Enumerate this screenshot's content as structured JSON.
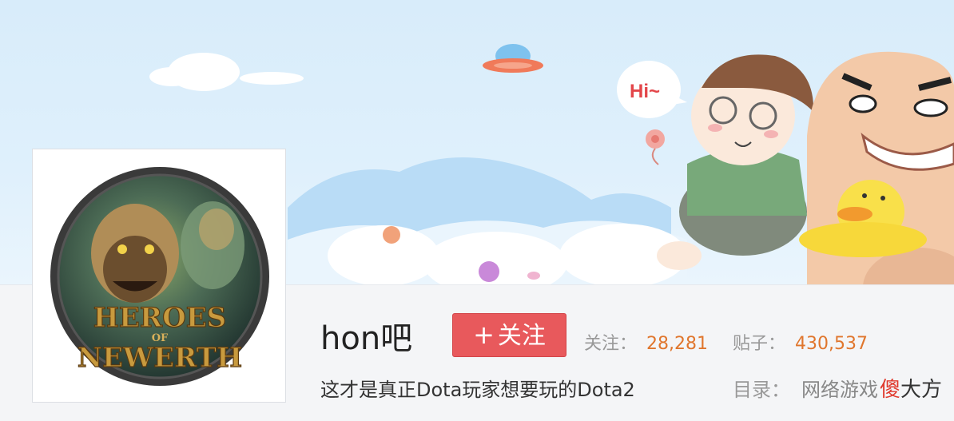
{
  "banner": {
    "speech_bubble": "Hi~"
  },
  "forum": {
    "logo_line1": "HEROES",
    "logo_line2": "OF",
    "logo_line3": "NEWERTH",
    "name": "hon吧",
    "follow_button": "关注",
    "follow_icon": "plus-icon",
    "followers_label": "关注：",
    "followers_value": "28,281",
    "posts_label": "贴子：",
    "posts_value": "430,537",
    "slogan": "这才是真正Dota玩家想要玩的Dota2",
    "catalog_label": "目录：",
    "catalog_value": "网络游戏"
  },
  "watermark": {
    "char1": "傻",
    "rest": "大方"
  },
  "colors": {
    "follow_button": "#e8595c",
    "stat_number": "#e0762d",
    "banner_sky": "#d8ecfa"
  }
}
